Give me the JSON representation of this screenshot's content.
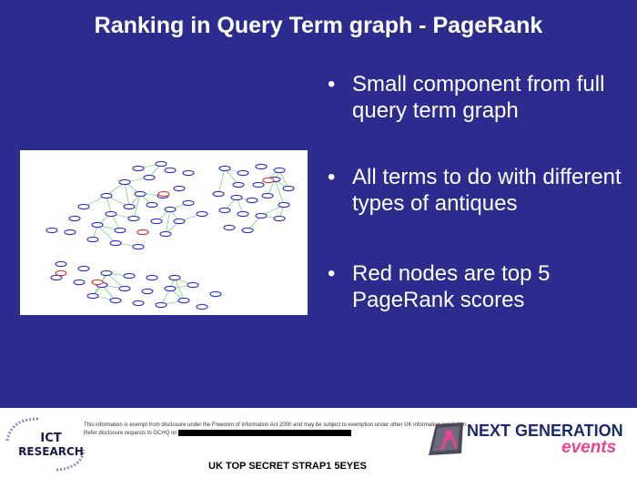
{
  "slide": {
    "title": "Ranking in Query Term graph - PageRank",
    "bullet_glyph": "•",
    "bullets": [
      "Small component from full query term graph",
      "All terms to do with different types of antiques",
      "Red nodes are top 5 PageRank scores"
    ]
  },
  "graph_image": {
    "node_color": "#2a2ad0",
    "highlight_color": "#e03030",
    "edge_color": "#4fc94f",
    "highlighted_node_count": 5
  },
  "footer": {
    "disclaimer_line1": "This information is exempt from disclosure under the Freedom of Information Act 2000 and may be subject to exemption under other UK information legislation.",
    "disclaimer_line2": "Refer disclosure requests to GCHQ on",
    "classification": "UK TOP SECRET STRAP1 5EYES",
    "ict_logo": {
      "line1": "ICT",
      "line2": "RESEARCH"
    },
    "ng_logo": {
      "line1": "NEXT GENERATION",
      "line2": "events",
      "accent": "#e9448f"
    }
  }
}
